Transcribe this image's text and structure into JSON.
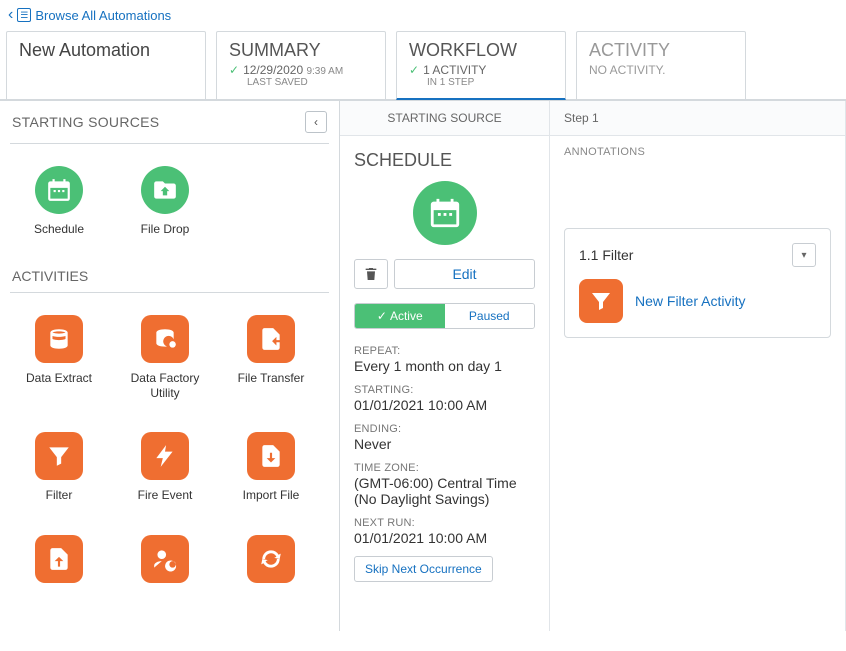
{
  "breadcrumb": {
    "label": "Browse All Automations"
  },
  "automation": {
    "name": "New Automation"
  },
  "header": {
    "summary": {
      "title": "SUMMARY",
      "date": "12/29/2020",
      "time": "9:39 AM",
      "saved": "LAST SAVED"
    },
    "workflow": {
      "title": "WORKFLOW",
      "line": "1 ACTIVITY",
      "sub": "IN 1 STEP"
    },
    "activity": {
      "title": "ACTIVITY",
      "sub": "NO ACTIVITY."
    }
  },
  "left": {
    "starting_sources_label": "STARTING SOURCES",
    "activities_label": "ACTIVITIES",
    "sources": [
      {
        "label": "Schedule",
        "icon": "calendar"
      },
      {
        "label": "File Drop",
        "icon": "folder"
      }
    ],
    "activities": [
      {
        "label": "Data Extract",
        "icon": "db"
      },
      {
        "label": "Data Factory Utility",
        "icon": "dbgear"
      },
      {
        "label": "File Transfer",
        "icon": "filetransfer"
      },
      {
        "label": "Filter",
        "icon": "funnel"
      },
      {
        "label": "Fire Event",
        "icon": "bolt"
      },
      {
        "label": "Import File",
        "icon": "fileimport"
      },
      {
        "label": "",
        "icon": "fileup"
      },
      {
        "label": "",
        "icon": "usergear"
      },
      {
        "label": "",
        "icon": "refresh"
      }
    ]
  },
  "canvas": {
    "schedule_col_head": "STARTING SOURCE",
    "step_col_head": "Step 1",
    "schedule_title": "SCHEDULE",
    "edit_label": "Edit",
    "active_label": "Active",
    "paused_label": "Paused",
    "fields": {
      "repeat_k": "REPEAT:",
      "repeat_v": "Every 1 month on day 1",
      "starting_k": "STARTING:",
      "starting_v": "01/01/2021 10:00 AM",
      "ending_k": "ENDING:",
      "ending_v": "Never",
      "tz_k": "TIME ZONE:",
      "tz_v": "(GMT-06:00) Central Time (No Daylight Savings)",
      "next_k": "NEXT RUN:",
      "next_v": "01/01/2021 10:00 AM"
    },
    "skip_label": "Skip Next Occurrence",
    "annotations_label": "ANNOTATIONS",
    "activity": {
      "num": "1.1 Filter",
      "name": "New Filter Activity"
    }
  }
}
